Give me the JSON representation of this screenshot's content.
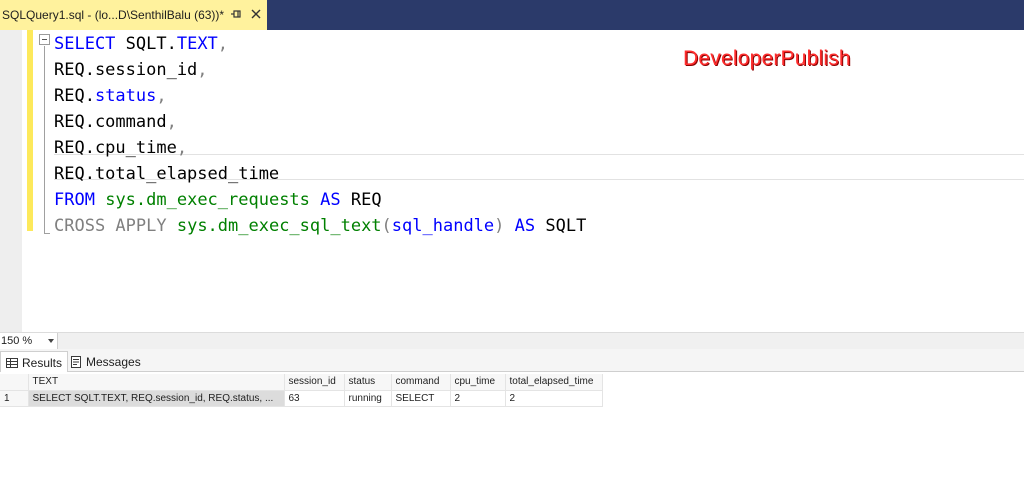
{
  "tab": {
    "title": "SQLQuery1.sql - (lo...D\\SenthilBalu (63))*",
    "pin_icon": "pin-icon",
    "close_icon": "close-icon"
  },
  "editor": {
    "watermark": "DeveloperPublish",
    "lines": [
      [
        {
          "t": "SELECT",
          "c": "kw"
        },
        {
          "t": " SQLT.",
          "c": ""
        },
        {
          "t": "TEXT",
          "c": "kw"
        },
        {
          "t": ",",
          "c": "gray"
        }
      ],
      [
        {
          "t": "REQ.session_id",
          "c": ""
        },
        {
          "t": ",",
          "c": "gray"
        }
      ],
      [
        {
          "t": "REQ.",
          "c": ""
        },
        {
          "t": "status",
          "c": "kw"
        },
        {
          "t": ",",
          "c": "gray"
        }
      ],
      [
        {
          "t": "REQ.command",
          "c": ""
        },
        {
          "t": ",",
          "c": "gray"
        }
      ],
      [
        {
          "t": "REQ.cpu_time",
          "c": ""
        },
        {
          "t": ",",
          "c": "gray"
        }
      ],
      [
        {
          "t": "REQ.total_elapsed_time",
          "c": ""
        }
      ],
      [
        {
          "t": "FROM",
          "c": "kw"
        },
        {
          "t": " ",
          "c": ""
        },
        {
          "t": "sys.dm_exec_requests",
          "c": "sys"
        },
        {
          "t": " ",
          "c": ""
        },
        {
          "t": "AS",
          "c": "kw"
        },
        {
          "t": " REQ",
          "c": ""
        }
      ],
      [
        {
          "t": "CROSS APPLY",
          "c": "gray"
        },
        {
          "t": " ",
          "c": ""
        },
        {
          "t": "sys.dm_exec_sql_text",
          "c": "sys"
        },
        {
          "t": "(",
          "c": "gray"
        },
        {
          "t": "sql_handle",
          "c": "kw"
        },
        {
          "t": ")",
          "c": "gray"
        },
        {
          "t": " ",
          "c": ""
        },
        {
          "t": "AS",
          "c": "kw"
        },
        {
          "t": " SQLT",
          "c": ""
        }
      ]
    ]
  },
  "zoom": {
    "value": "150 %"
  },
  "results_tabs": [
    {
      "label": "Results",
      "active": true,
      "icon": "grid-icon"
    },
    {
      "label": "Messages",
      "active": false,
      "icon": "messages-icon"
    }
  ],
  "grid": {
    "columns": [
      "TEXT",
      "session_id",
      "status",
      "command",
      "cpu_time",
      "total_elapsed_time"
    ],
    "rows": [
      {
        "num": "1",
        "cells": [
          "SELECT SQLT.TEXT,  REQ.session_id,  REQ.status,  ...",
          "63",
          "running",
          "SELECT",
          "2",
          "2"
        ]
      }
    ]
  },
  "colors": {
    "tab_active": "#fff29d",
    "tabstrip": "#2b3a6a",
    "keyword": "#0000ff",
    "system_object": "#008000",
    "operator": "#808080",
    "watermark": "#ff2d2d",
    "change_marker": "#fde95b"
  }
}
